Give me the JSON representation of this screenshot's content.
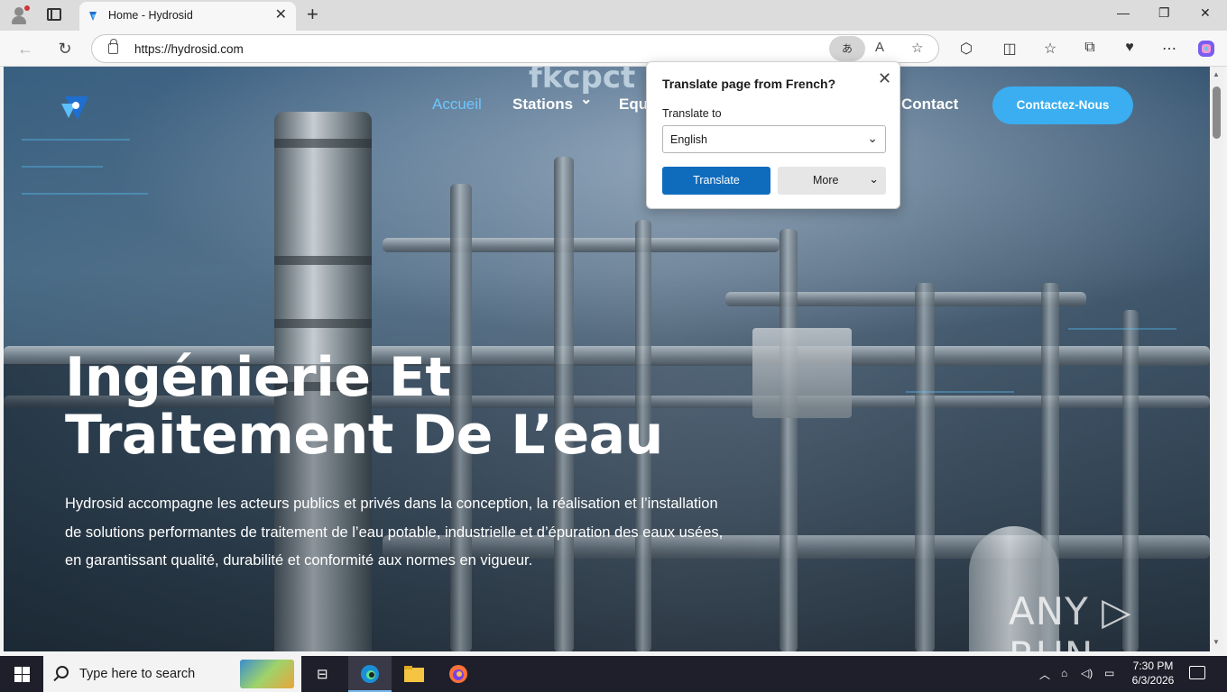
{
  "browser": {
    "tab_title": "Home - Hydrosid",
    "url": "https://hydrosid.com",
    "translate_pill": "あ",
    "win_minimize": "—",
    "win_restore": "❐",
    "win_close": "✕",
    "new_tab": "+",
    "tab_close": "✕"
  },
  "site": {
    "nav": {
      "home": "Accueil",
      "stations": "Stations",
      "stations_chevron": "⌄",
      "equipment": "Equ",
      "contact": "Contact",
      "bg_sign": "fkcpct"
    },
    "cta": "Contactez-Nous",
    "hero_title": "Ingénierie Et Traitement De L’eau",
    "hero_text": "Hydrosid accompagne les acteurs publics et privés dans la conception, la réalisation et l’installation de solutions performantes de traitement de l’eau potable, industrielle et d’épuration des eaux usées, en garantissant qualité, durabilité et conformité aux normes en vigueur.",
    "accent_color": "#3aaef0"
  },
  "translate_popup": {
    "title": "Translate page from French?",
    "label": "Translate to",
    "selected_language": "English",
    "translate_button": "Translate",
    "more_button": "More",
    "primary_color": "#0f6cbd"
  },
  "watermark": "ANY ▷ RUN",
  "taskbar": {
    "search_placeholder": "Type here to search",
    "time": "7:30 PM",
    "date": "6/3/2026"
  }
}
